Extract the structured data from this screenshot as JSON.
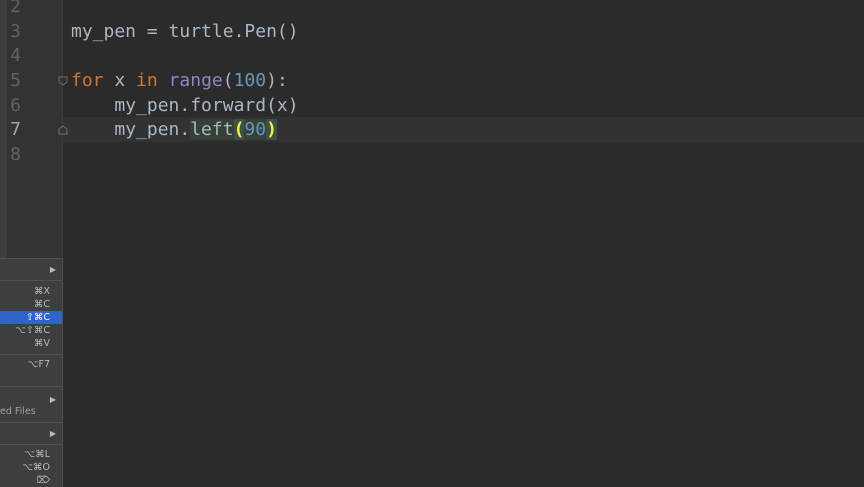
{
  "editor": {
    "line_numbers": [
      "2",
      "3",
      "4",
      "5",
      "6",
      "7",
      "8"
    ],
    "current_line": "7",
    "lines": {
      "l3": {
        "var": "my_pen",
        "op": " = ",
        "call": "turtle.Pen()"
      },
      "l5": {
        "kw_for": "for",
        "var": " x ",
        "kw_in": "in",
        "sp": " ",
        "builtin": "range",
        "open": "(",
        "num": "100",
        "close": "):"
      },
      "l6": {
        "indent": "    ",
        "obj": "my_pen.",
        "method": "forward",
        "args": "(x)"
      },
      "l7": {
        "indent": "    ",
        "obj": "my_pen.",
        "method": "left",
        "open": "(",
        "num": "90",
        "close": ")"
      }
    }
  },
  "context_menu": {
    "items": [
      {
        "shortcut": "",
        "submenu": true
      },
      {
        "shortcut": "⌘X"
      },
      {
        "shortcut": "⌘C"
      },
      {
        "shortcut": "⇧⌘C",
        "selected": true
      },
      {
        "shortcut": "⌥⇧⌘C"
      },
      {
        "shortcut": "⌘V"
      },
      {
        "shortcut": "⌥F7"
      },
      {
        "label": "ed Files",
        "submenu": true
      },
      {
        "shortcut": "",
        "submenu": true
      },
      {
        "shortcut": "⌥⌘L"
      },
      {
        "shortcut": "⌥⌘O"
      },
      {
        "shortcut": "⌦"
      }
    ],
    "submenu_arrow": "▶"
  },
  "colors": {
    "background": "#2b2b2b",
    "gutter": "#313335",
    "keyword": "#cc7832",
    "builtin": "#8888c6",
    "number": "#6897bb",
    "text": "#a9b7c6",
    "brace_match": "#ffef28",
    "menu_selection": "#2f65ca"
  }
}
